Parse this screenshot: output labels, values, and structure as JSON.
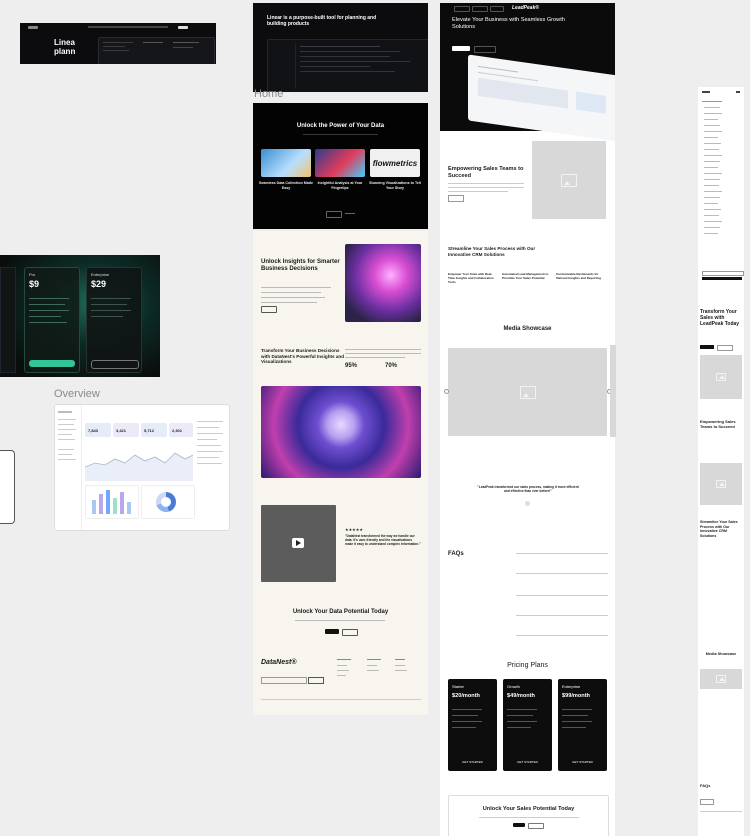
{
  "sections": {
    "home": "Home",
    "overview": "Overview"
  },
  "linear": {
    "headline": "Linear is a purpose-built tool for planning and building products",
    "crop_title": "Linea plann"
  },
  "dark_features": {
    "title": "Unlock the Power of Your Data",
    "cards": [
      {
        "title": "Seamless Data Collection Made Easy"
      },
      {
        "title": "Insightful Analysis at Your Fingertips"
      },
      {
        "title": "Stunning Visualizations to Tell Your Story"
      }
    ],
    "logo_text": "flowmetrics"
  },
  "pricing_dark": {
    "plans": [
      {
        "name": "Pro",
        "price": "$9"
      },
      {
        "name": "Enterprise",
        "price": "$29"
      }
    ]
  },
  "cream_page": {
    "hero_title": "Unlock Insights for Smarter Business Decisions",
    "section2_title": "Transform Your Business Decisions with DataNest's Powerful Insights and Visualizations",
    "stat1": "95%",
    "stat2": "70%",
    "testimonial": "\"DataNest transformed the way we handle our data. It's user-friendly and the visualizations make it easy to understand complex information.\"",
    "stars": "★★★★★",
    "cta_title": "Unlock Your Data Potential Today",
    "footer_logo": "DataNest®"
  },
  "leadpeak": {
    "logo": "LeadPeak®",
    "hero_title": "Elevate Your Business with Seamless Growth Solutions",
    "section_title": "Empowering Sales Teams to Succeed",
    "crm_title": "Streamline Your Sales Process with Our Innovative CRM Solutions",
    "crm_items": [
      "Empower Your Team with Real-Time Insights and Collaboration Tools",
      "Automated Lead Management to Prioritize Your Sales Potential",
      "Customizable Dashboards for Tailored Insights and Reporting"
    ],
    "media_title": "Media Showcase",
    "quote": "\"LeadPeak transformed our sales process, making it more efficient and effective than ever before!\"",
    "faq_title": "FAQs",
    "pricing_title": "Pricing Plans",
    "plans": [
      {
        "name": "Starter",
        "price": "$20/month"
      },
      {
        "name": "Growth",
        "price": "$49/month"
      },
      {
        "name": "Enterprise",
        "price": "$99/month"
      }
    ],
    "cta_button": "GET STARTED",
    "bottom_title": "Unlock Your Sales Potential Today"
  },
  "mobile": {
    "title": "Transform Your Sales with LeadPeak Today",
    "section_title": "Empowering Sales Teams to Succeed",
    "crm_title": "Streamline Your Sales Process with Our Innovative CRM Solutions",
    "media_title": "Media Showcase",
    "faq_title": "FAQs"
  },
  "overview": {
    "metrics": [
      "7,843",
      "3,421",
      "5,712",
      "2,301"
    ]
  }
}
